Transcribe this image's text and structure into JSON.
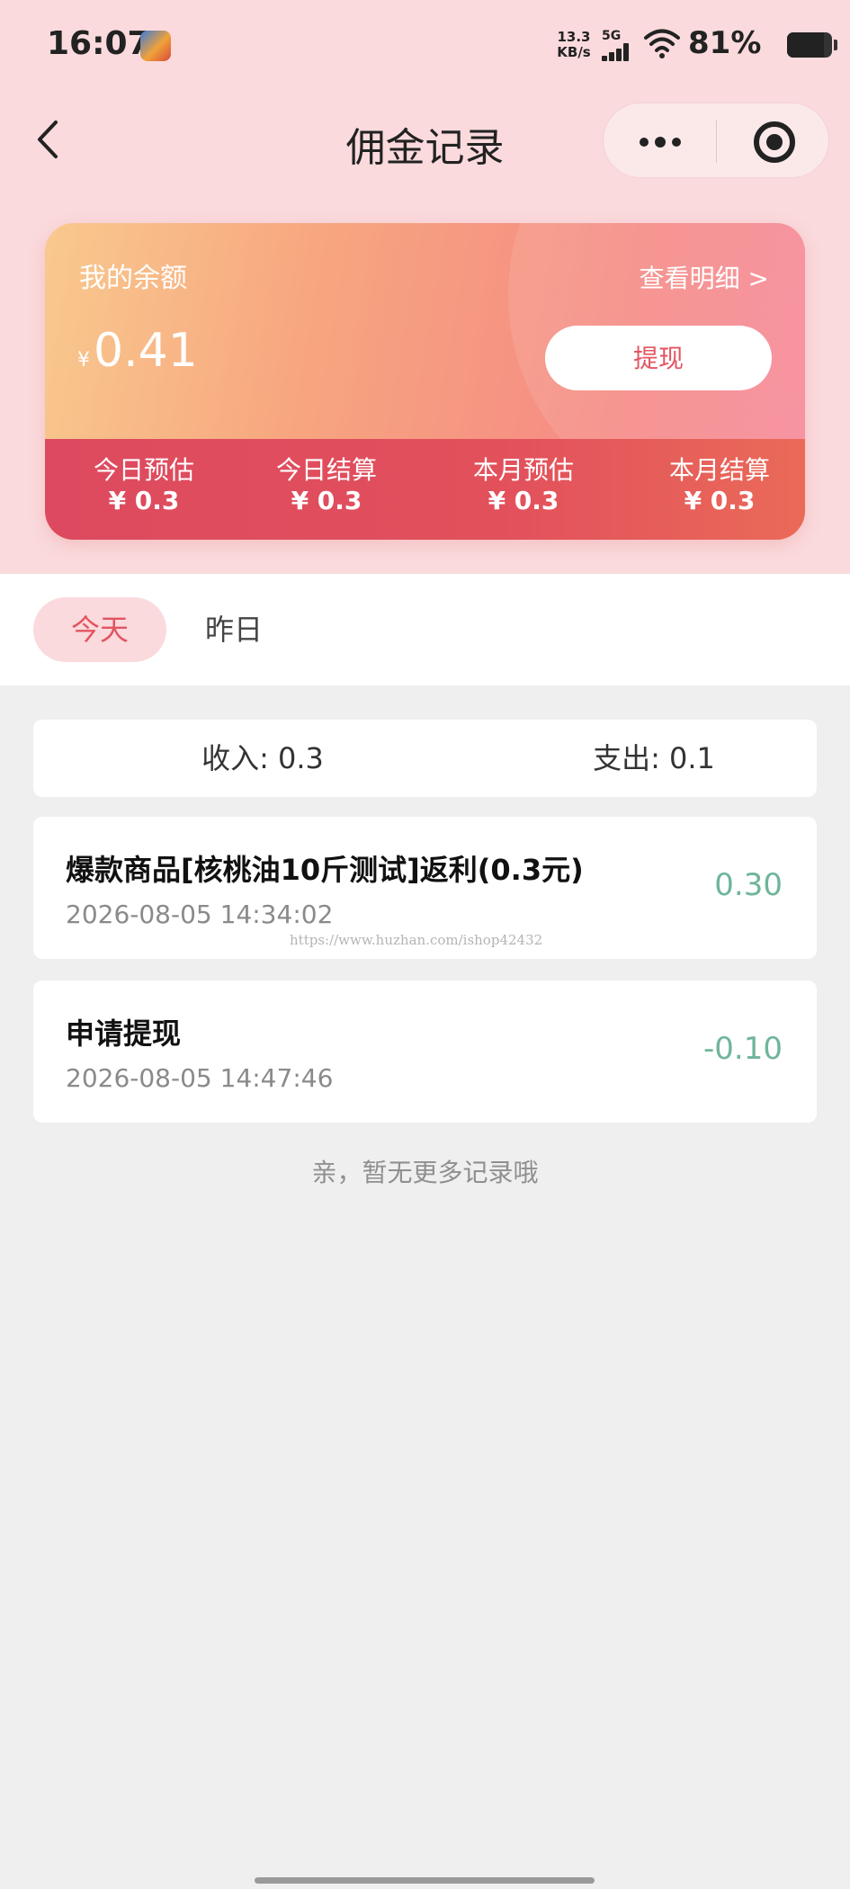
{
  "status_bar": {
    "time": "16:07",
    "net_speed_value": "13.3",
    "net_speed_unit": "KB/s",
    "network": "5G",
    "battery_percent": "81%",
    "battery_level": 0.81
  },
  "nav": {
    "title": "佣金记录"
  },
  "balance_card": {
    "label": "我的余额",
    "detail_link": "查看明细 >",
    "currency": "¥",
    "amount": "0.41",
    "withdraw_label": "提现",
    "stats": [
      {
        "label": "今日预估",
        "value": "¥ 0.3"
      },
      {
        "label": "今日结算",
        "value": "¥ 0.3"
      },
      {
        "label": "本月预估",
        "value": "¥ 0.3"
      },
      {
        "label": "本月结算",
        "value": "¥ 0.3"
      }
    ]
  },
  "tabs": [
    {
      "label": "今天",
      "active": true
    },
    {
      "label": "昨日",
      "active": false
    }
  ],
  "summary": {
    "income": "收入: 0.3",
    "expense": "支出: 0.1"
  },
  "records": [
    {
      "title": "爆款商品[核桃油10斤测试]返利(0.3元)",
      "time": "2026-08-05 14:34:02",
      "amount": "0.30"
    },
    {
      "title": "申请提现",
      "time": "2026-08-05 14:47:46",
      "amount": "-0.10"
    }
  ],
  "watermark": "https://www.huzhan.com/ishop42432",
  "end_hint": "亲，暂无更多记录哦",
  "colors": {
    "accent": "#e25561",
    "page_top_bg": "#fadadd",
    "amount_green": "#6fb59a"
  }
}
